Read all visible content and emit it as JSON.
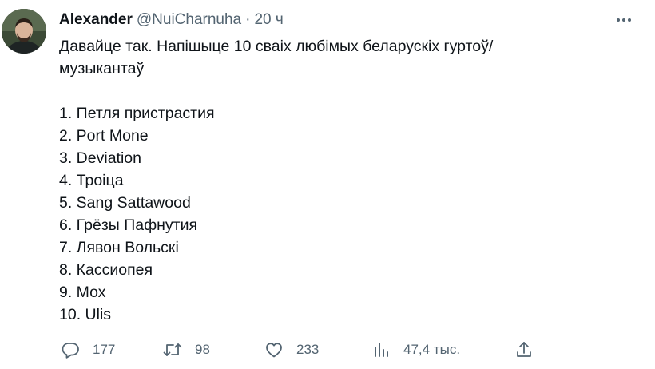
{
  "tweet": {
    "author_name": "Alexander",
    "author_handle": "@NuiCharnuha",
    "separator": "·",
    "time": "20 ч",
    "text_lines": [
      "Давайце так. Напішыце 10 сваіх любімых беларускіх гуртоў/",
      "музыкантаў",
      "",
      "1. Петля пристрастия",
      "2. Port Mone",
      "3. Deviation",
      "4. Троіца",
      "5. Sang Sattawood",
      "6. Грёзы Пафнутия",
      "7. Лявон Вольскі",
      "8. Кассиопея",
      "9. Мох",
      "10. Ulis"
    ]
  },
  "actions": {
    "replies": "177",
    "retweets": "98",
    "likes": "233",
    "views": "47,4 тыс."
  },
  "icons": {
    "more": "more-horizontal-icon",
    "reply": "reply-bubble-icon",
    "retweet": "retweet-arrows-icon",
    "like": "heart-icon",
    "views": "bar-chart-icon",
    "share": "share-upload-icon"
  },
  "colors": {
    "text_primary": "#0f1419",
    "text_secondary": "#536471"
  }
}
